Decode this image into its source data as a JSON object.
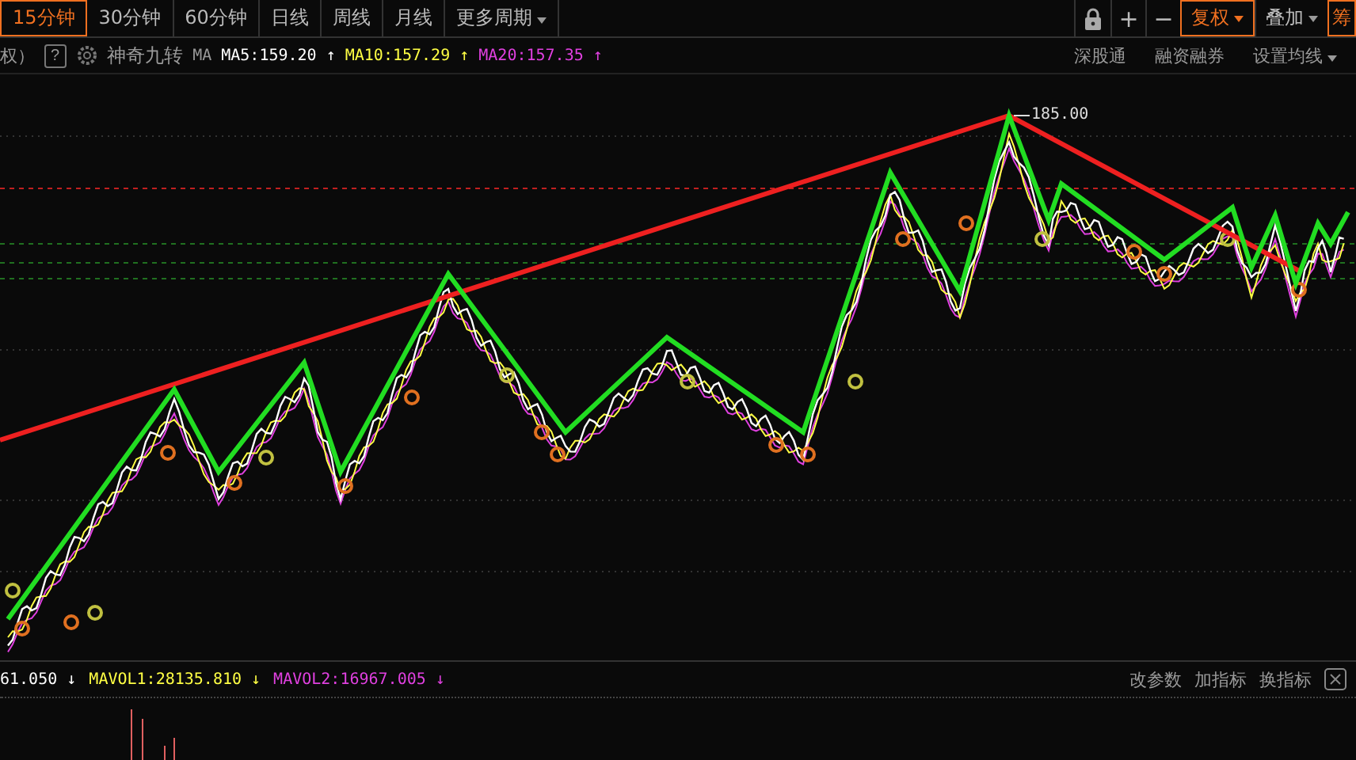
{
  "period_tabs": [
    {
      "label": "15分钟",
      "selected": true
    },
    {
      "label": "30分钟",
      "selected": false
    },
    {
      "label": "60分钟",
      "selected": false
    },
    {
      "label": "日线",
      "selected": false
    },
    {
      "label": "周线",
      "selected": false
    },
    {
      "label": "月线",
      "selected": false
    },
    {
      "label": "更多周期",
      "selected": false,
      "dropdown": true
    }
  ],
  "tool_buttons": [
    {
      "kind": "lock"
    },
    {
      "kind": "text",
      "label": "+"
    },
    {
      "kind": "text",
      "label": "−"
    },
    {
      "kind": "menu",
      "label": "复权",
      "selected": true,
      "dropdown": true
    },
    {
      "kind": "menu",
      "label": "叠加",
      "selected": false,
      "dropdown": true
    },
    {
      "kind": "cut",
      "label": "筹",
      "selected": true
    }
  ],
  "indicator_bar": {
    "prefix": "权）",
    "help": "?",
    "indicator_name": "神奇九转",
    "ma_label": "MA",
    "ma_values": [
      {
        "text": "MA5:159.20",
        "arrow": "↑",
        "color": "#ffffff"
      },
      {
        "text": "MA10:157.29",
        "arrow": "↑",
        "color": "#ffff44"
      },
      {
        "text": "MA20:157.35",
        "arrow": "↑",
        "color": "#e040e0"
      }
    ],
    "links": [
      {
        "label": "深股通",
        "dropdown": false
      },
      {
        "label": "融资融券",
        "dropdown": false
      },
      {
        "label": "设置均线",
        "dropdown": true
      }
    ]
  },
  "price_chart": {
    "peak_label": "185.00"
  },
  "volume_bar": {
    "values": [
      {
        "text": "61.050",
        "arrow": "↓",
        "color": "#ffffff"
      },
      {
        "text": "MAVOL1:28135.810",
        "arrow": "↓",
        "color": "#ffff44"
      },
      {
        "text": "MAVOL2:16967.005",
        "arrow": "↓",
        "color": "#e040e0"
      }
    ],
    "actions": [
      "改参数",
      "加指标",
      "换指标"
    ]
  }
}
